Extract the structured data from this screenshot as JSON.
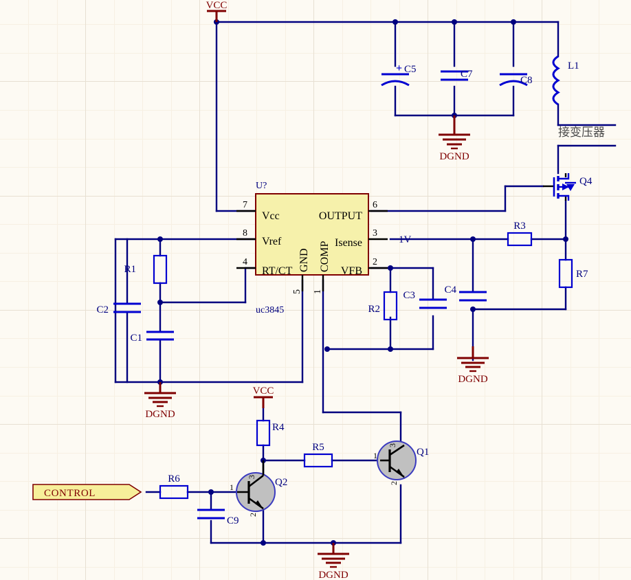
{
  "sheet": {
    "background_color": "#fdfaf3",
    "grid_minor_color": "#f6efe2",
    "grid_major_color": "#e8e2d6",
    "wire_color": "#00007f",
    "component_color": "#0000d0",
    "pin_color": "#000000",
    "power_color": "#7f0000",
    "label_color": "#00007f",
    "text_color": "#000000",
    "transistor_fill": "#c0c0c0",
    "ic_fill": "#f6f1ab",
    "ic_border": "#7f0000",
    "flag_fill": "#f7ef9a"
  },
  "ic": {
    "refdes": "U?",
    "value": "uc3845",
    "pins": [
      {
        "number": "7",
        "name": "Vcc",
        "side": "left"
      },
      {
        "number": "8",
        "name": "Vref",
        "side": "left"
      },
      {
        "number": "4",
        "name": "RT/CT",
        "side": "left"
      },
      {
        "number": "6",
        "name": "OUTPUT",
        "side": "right"
      },
      {
        "number": "3",
        "name": "Isense",
        "side": "right"
      },
      {
        "number": "2",
        "name": "VFB",
        "side": "right"
      },
      {
        "number": "5",
        "name": "GND",
        "side": "bottom"
      },
      {
        "number": "1",
        "name": "COMP",
        "side": "bottom"
      }
    ]
  },
  "components": {
    "resistors": [
      {
        "ref": "R1"
      },
      {
        "ref": "R2"
      },
      {
        "ref": "R3"
      },
      {
        "ref": "R4"
      },
      {
        "ref": "R5"
      },
      {
        "ref": "R6"
      },
      {
        "ref": "R7"
      }
    ],
    "capacitors": [
      {
        "ref": "C1",
        "polarized": false
      },
      {
        "ref": "C2",
        "polarized": false
      },
      {
        "ref": "C3",
        "polarized": false
      },
      {
        "ref": "C4",
        "polarized": false
      },
      {
        "ref": "C5",
        "polarized": true,
        "plus": "+"
      },
      {
        "ref": "C7",
        "polarized": false
      },
      {
        "ref": "C8",
        "polarized": true
      },
      {
        "ref": "C9",
        "polarized": false
      }
    ],
    "inductors": [
      {
        "ref": "L1"
      }
    ],
    "transistors": [
      {
        "ref": "Q1",
        "type": "npn",
        "pins": {
          "base": "1",
          "emitter": "2",
          "collector": "3"
        }
      },
      {
        "ref": "Q2",
        "type": "npn",
        "pins": {
          "base": "1",
          "emitter": "2",
          "collector": "3"
        }
      }
    ],
    "mosfets": [
      {
        "ref": "Q4",
        "type": "n-channel"
      }
    ]
  },
  "power_symbols": [
    {
      "name": "VCC",
      "id": "vcc-top"
    },
    {
      "name": "VCC",
      "id": "vcc-r4"
    },
    {
      "name": "DGND",
      "id": "dgnd-caps"
    },
    {
      "name": "DGND",
      "id": "dgnd-left"
    },
    {
      "name": "DGND",
      "id": "dgnd-c4"
    },
    {
      "name": "DGND",
      "id": "dgnd-bottom"
    }
  ],
  "net_labels": [
    {
      "text": "1V",
      "id": "net-1v"
    }
  ],
  "port_flags": [
    {
      "text": "CONTROL",
      "id": "control-flag"
    }
  ],
  "annotations": [
    {
      "text": "接变压器",
      "id": "transformer-note"
    }
  ]
}
